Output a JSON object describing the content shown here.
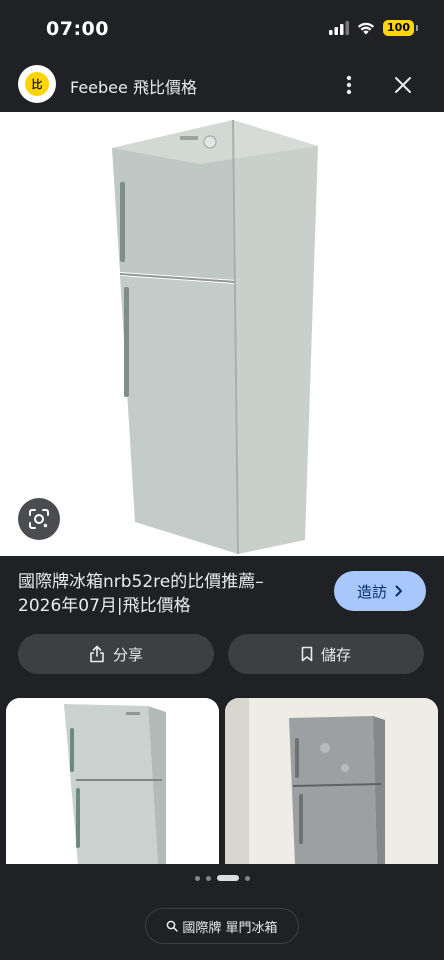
{
  "status": {
    "time": "07:00",
    "battery": "100"
  },
  "header": {
    "site_name": "Feebee 飛比價格",
    "logo_text": "比"
  },
  "result": {
    "title_line1": "國際牌冰箱nrb52re的比價推薦–",
    "title_line2": "2026年07月|飛比價格",
    "visit_label": "造訪"
  },
  "actions": {
    "share_label": "分享",
    "save_label": "儲存"
  },
  "carousel": {
    "page_count": 4,
    "active_index": 2
  },
  "search_chip": {
    "label": "國際牌 單門冰箱"
  },
  "colors": {
    "background": "#202124",
    "accent": "#a8c7fa",
    "battery": "#ffd60a",
    "button": "#3c4043"
  },
  "icons": [
    "signal-icon",
    "wifi-icon",
    "battery-icon",
    "more-vert-icon",
    "close-icon",
    "lens-icon",
    "chevron-right-icon",
    "share-icon",
    "bookmark-icon",
    "search-icon"
  ]
}
